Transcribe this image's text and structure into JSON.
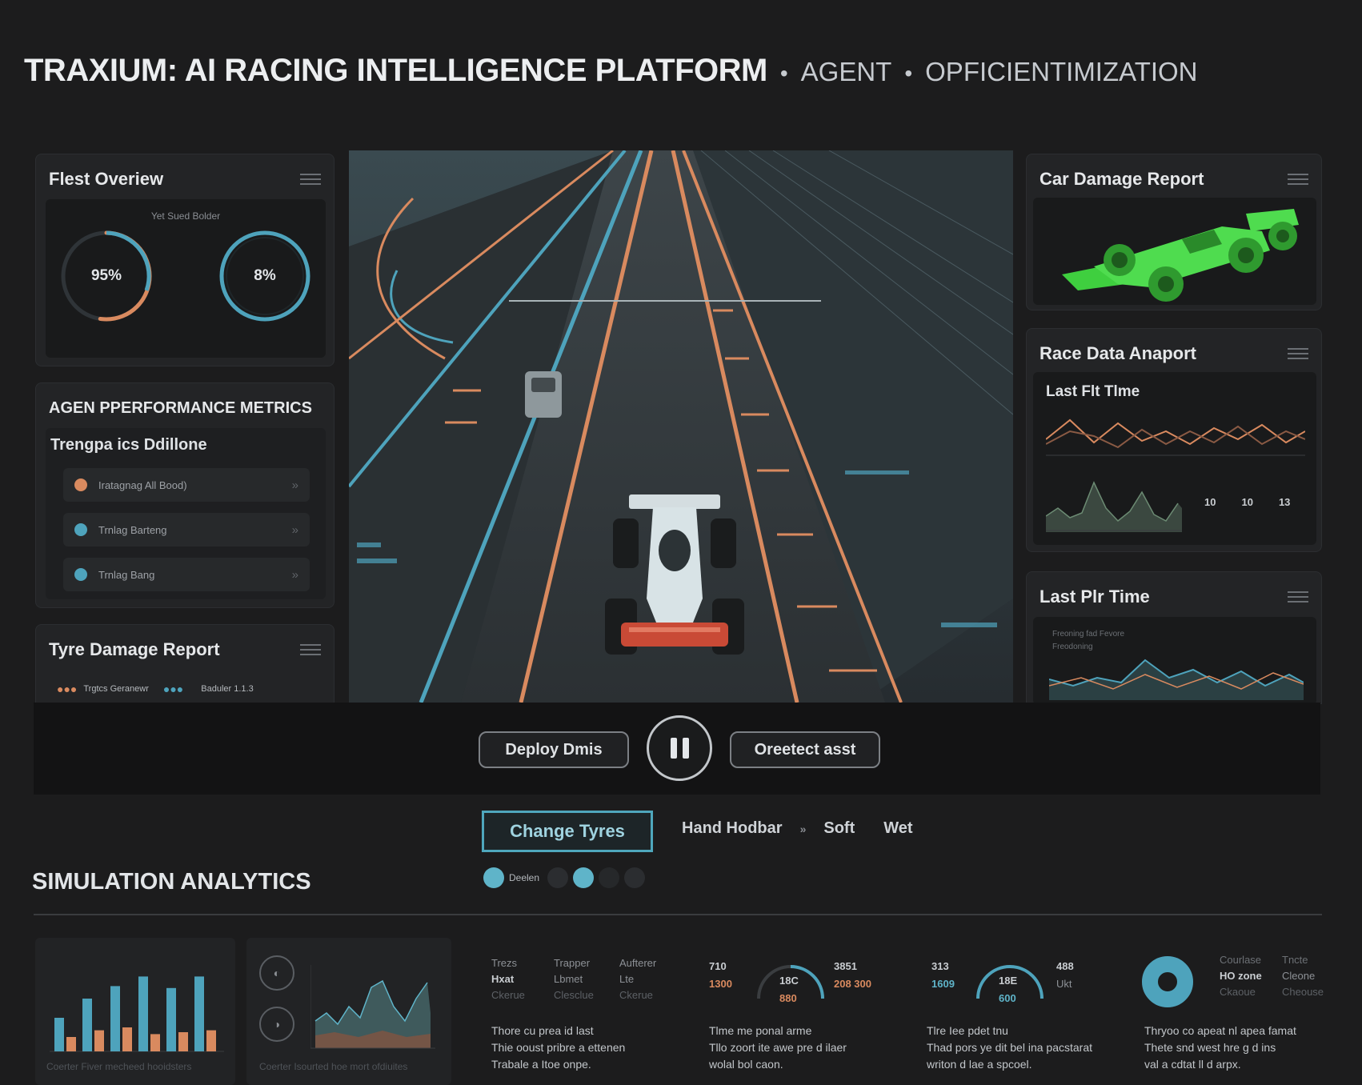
{
  "header": {
    "title": "TRAXIUM: AI RACING INTELLIGENCE PLATFORM",
    "crumb1": "AGENT",
    "crumb2": "OPFICIENTIMIZATION"
  },
  "fleet": {
    "title": "Flest Overiew",
    "caption": "Yet Sued Bolder",
    "ring1": {
      "label": "95%",
      "value": 0.95
    },
    "ring2": {
      "label": "8%",
      "value": 0.08
    }
  },
  "agent_metrics": {
    "title": "AGEN PPERFORMANCE METRICS",
    "subtitle": "Trengpa ics Ddillone",
    "rows": [
      {
        "label": "Iratagnag All Bood)",
        "color": "#d98a5f"
      },
      {
        "label": "Trnlag Barteng",
        "color": "#4ea3bc"
      },
      {
        "label": "Trnlag Bang",
        "color": "#4ea3bc"
      }
    ]
  },
  "tyre_report": {
    "title": "Tyre Damage Report",
    "legend1": "Trgtcs Geranewr",
    "legend2": "Baduler 1.1.3"
  },
  "car_damage": {
    "title": "Car Damage Report"
  },
  "race_data": {
    "title": "Race Data Anaport",
    "subtitle": "Last Flt Tlme",
    "stats": [
      "10",
      "10",
      "13"
    ]
  },
  "last_pit": {
    "title": "Last Plr Time",
    "caption1": "Freoning fad Fevore",
    "caption2": "Freodoning"
  },
  "controls": {
    "deploy": "Deploy Dmis",
    "orient": "Oreetect asst"
  },
  "tyres": {
    "button": "Change Tyres",
    "opt1": "Hand Hodbar",
    "arrow": "»",
    "opt2": "Soft",
    "opt3": "Wet",
    "toggle_label": "Deelen"
  },
  "simulation": {
    "title": "SIMULATION ANALYTICS",
    "bar_caption": "Coerter Fiver mecheed hooidsters",
    "area_caption": "Coerter Isourted hoe mort ofdiuites",
    "bar_chart": [
      {
        "a": 0.35,
        "b": 0.15
      },
      {
        "a": 0.55,
        "b": 0.22
      },
      {
        "a": 0.68,
        "b": 0.25
      },
      {
        "a": 0.78,
        "b": 0.18
      },
      {
        "a": 0.66,
        "b": 0.2
      },
      {
        "a": 0.78,
        "b": 0.22
      }
    ],
    "col1": {
      "h1": "Trezs",
      "h2": "Trapper",
      "h3": "Aufterer",
      "r1a": "Hxat",
      "r1b": "Lbmet",
      "r1c": "Lte",
      "r2a": "Ckerue",
      "r2b": "Clesclue",
      "r2c": "Ckerue",
      "desc1": "Thore cu prea id last",
      "desc2": "Thie ooust pribre a ettenen",
      "desc3": "Trabale a Itoe onpe."
    },
    "gauge1": {
      "left_top": "710",
      "left_bot": "1300",
      "center_top": "18C",
      "center_bot": "880",
      "right_top": "3851",
      "right_bot": "208 300",
      "desc1": "Tlme me ponal arme",
      "desc2": "Tllo zoort ite awe pre d ilaer",
      "desc3": "wolal bol caon."
    },
    "gauge2": {
      "left_top": "313",
      "left_bot": "1609",
      "center_top": "18E",
      "center_bot": "600",
      "right_top": "488",
      "right_bot": "Ukt",
      "desc1": "Tlre Iee pdet tnu",
      "desc2": "Thad pors ye dit bel ina pacstarat",
      "desc3": "writon d lae a spcoel."
    },
    "donut": {
      "h1": "Courlase",
      "h2": "Tncte",
      "r1a": "HO zone",
      "r1b": "Cleone",
      "r2a": "Ckaoue",
      "r2b": "Cheouse",
      "desc1": "Thryoo co apeat nl apea famat",
      "desc2": "Thete snd west hre g d ins",
      "desc3": "val a cdtat ll d arpx."
    }
  },
  "colors": {
    "accent_teal": "#4ea3bc",
    "accent_orange": "#d98a5f",
    "car_green": "#4fdc4f",
    "background": "#1c1c1d"
  }
}
